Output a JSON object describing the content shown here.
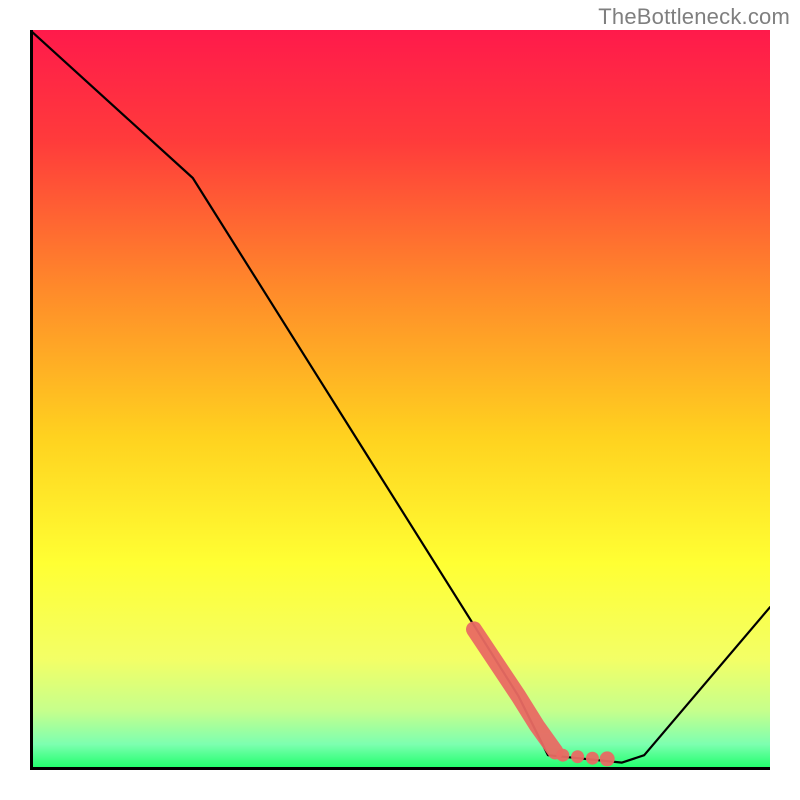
{
  "watermark_text": "TheBottleneck.com",
  "chart_data": {
    "type": "line",
    "title": "",
    "xlabel": "",
    "ylabel": "",
    "xlim": [
      0,
      100
    ],
    "ylim": [
      0,
      100
    ],
    "series": [
      {
        "name": "bottleneck-curve",
        "x": [
          0,
          22,
          66,
          70,
          80,
          83,
          100
        ],
        "y": [
          100,
          80,
          10,
          2,
          1,
          2,
          22
        ]
      }
    ],
    "highlight_segment": {
      "name": "optimal-range",
      "x": [
        60,
        63,
        66,
        68.5,
        71,
        72,
        74,
        76,
        78
      ],
      "y": [
        19,
        14.5,
        10,
        6,
        2.5,
        2,
        1.8,
        1.6,
        1.5
      ]
    },
    "gradient_stops": [
      {
        "offset": 0.0,
        "color": "#ff1a4b"
      },
      {
        "offset": 0.15,
        "color": "#ff3b3b"
      },
      {
        "offset": 0.35,
        "color": "#ff8a2a"
      },
      {
        "offset": 0.55,
        "color": "#ffd21f"
      },
      {
        "offset": 0.72,
        "color": "#ffff33"
      },
      {
        "offset": 0.85,
        "color": "#f3ff66"
      },
      {
        "offset": 0.92,
        "color": "#c6ff8c"
      },
      {
        "offset": 0.965,
        "color": "#7dffb0"
      },
      {
        "offset": 1.0,
        "color": "#18ff66"
      }
    ]
  }
}
